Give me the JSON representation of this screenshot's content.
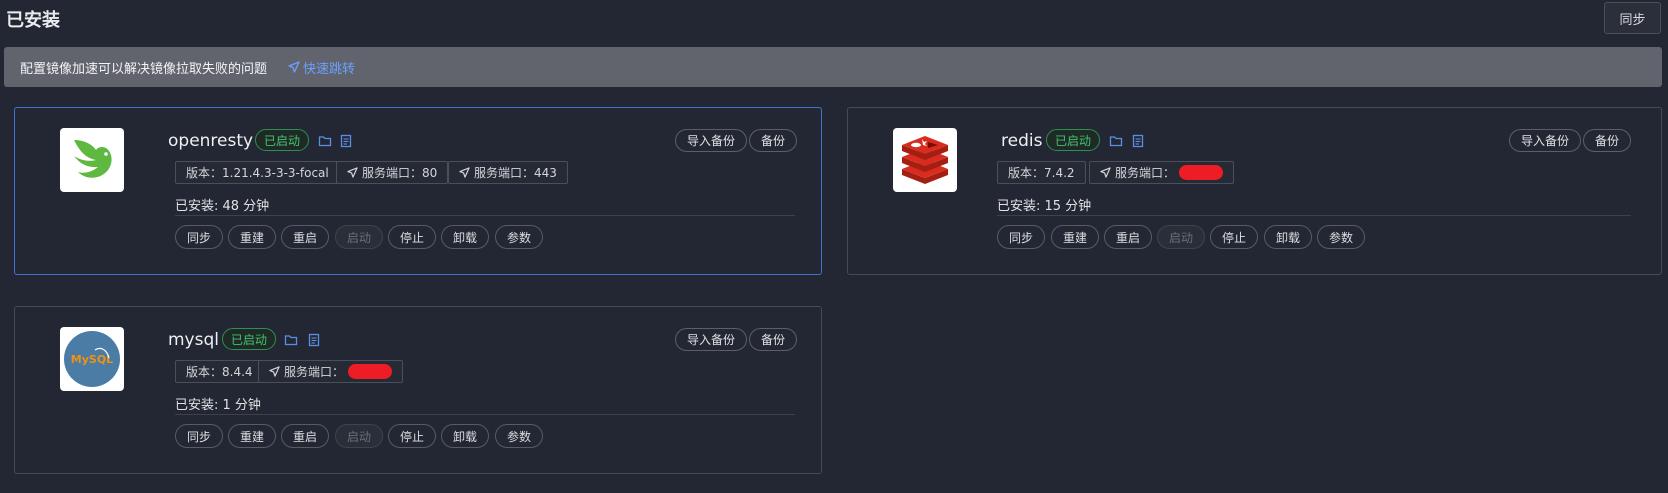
{
  "header": {
    "title": "已安装",
    "sync_label": "同步"
  },
  "notice": {
    "text": "配置镜像加速可以解决镜像拉取失败的问题",
    "link_label": "快速跳转"
  },
  "apps": [
    {
      "name": "openresty",
      "status": "已启动",
      "import_backup": "导入备份",
      "backup": "备份",
      "version": "版本：1.21.4.3-3-3-focal",
      "port1": "服务端口：80",
      "port2": "服务端口：443",
      "installed": "已安装:   48 分钟",
      "actions": [
        "同步",
        "重建",
        "重启",
        "启动",
        "停止",
        "卸载",
        "参数"
      ]
    },
    {
      "name": "redis",
      "status": "已启动",
      "import_backup": "导入备份",
      "backup": "备份",
      "version": "版本：7.4.2",
      "port1": "服务端口：",
      "installed": "已安装:   15 分钟",
      "actions": [
        "同步",
        "重建",
        "重启",
        "启动",
        "停止",
        "卸载",
        "参数"
      ]
    },
    {
      "name": "mysql",
      "status": "已启动",
      "import_backup": "导入备份",
      "backup": "备份",
      "version": "版本：8.4.4",
      "port1": "服务端口：",
      "installed": "已安装:   1 分钟",
      "logo_text": "MySQL",
      "actions": [
        "同步",
        "重建",
        "重启",
        "启动",
        "停止",
        "卸载",
        "参数"
      ]
    }
  ],
  "colors": {
    "background": "#232733",
    "accent_blue": "#3f73d0",
    "status_green": "#47c06e",
    "redact_red": "#ee1c24"
  },
  "icons": {
    "folder": "folder-icon",
    "doc": "document-icon",
    "navigate": "navigate-arrow-icon"
  }
}
